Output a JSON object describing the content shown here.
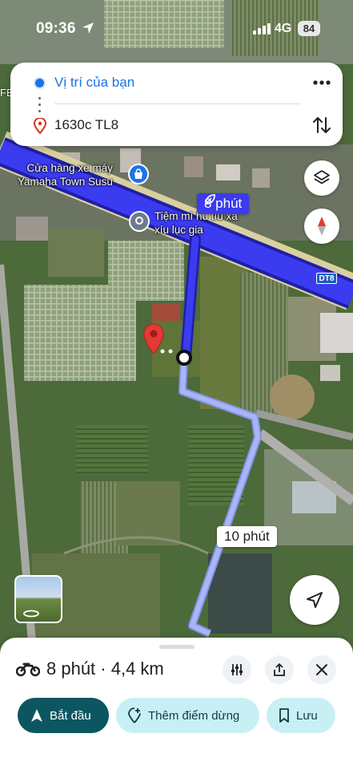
{
  "status_bar": {
    "time": "09:36",
    "network": "4G",
    "battery": "84"
  },
  "route": {
    "origin": "Vị trí của bạn",
    "destination": "1630c TL8"
  },
  "map_labels": {
    "edge_label": "FE",
    "poi_shop": "Cửa hàng xe máy\nYamaha Town Susu",
    "poi_store": "Tiệm mì hủ tíu xá\nxíu lục gia",
    "road": "DT8",
    "route_primary_time": "8 phút",
    "route_alt_time": "10 phút"
  },
  "trip": {
    "mode": "motorbike",
    "summary": "8 phút · 4,4 km"
  },
  "actions": {
    "start": "Bắt đầu",
    "add_stop": "Thêm điểm dừng",
    "save": "Lưu"
  },
  "colors": {
    "route_primary": "#3b3bf0",
    "route_alt": "#a9b6f6",
    "accent": "#0b5661",
    "chip_bg": "#c8f0f4",
    "link_blue": "#1a73e8",
    "pin_red": "#e53935"
  },
  "icons": [
    "location-arrow-icon",
    "signal-icon",
    "origin-dot-icon",
    "destination-pin-icon",
    "more-icon",
    "swap-icon",
    "layers-icon",
    "compass-icon",
    "shopping-bag-icon",
    "place-icon",
    "leaf-icon",
    "recenter-icon",
    "street-view-icon",
    "motorbike-icon",
    "options-icon",
    "share-icon",
    "close-icon",
    "navigation-icon",
    "add-location-icon",
    "bookmark-icon"
  ]
}
